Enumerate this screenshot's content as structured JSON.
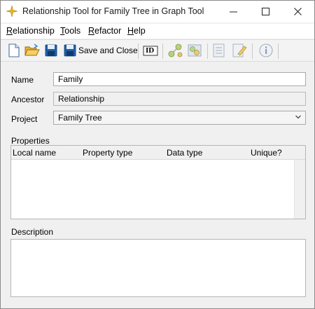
{
  "window": {
    "title": "Relationship Tool for Family Tree in Graph Tool",
    "icon": "sparkle-star-icon",
    "controls": [
      "minimize-icon",
      "maximize-icon",
      "close-icon"
    ]
  },
  "menu": {
    "relationship": {
      "first": "R",
      "rest": "elationship"
    },
    "tools": {
      "first": "T",
      "rest": "ools"
    },
    "refactor": {
      "first": "R",
      "rest": "efactor"
    },
    "help": {
      "first": "H",
      "rest": "elp"
    }
  },
  "toolbar": {
    "save_close_label": "Save and Close",
    "id_label": "ID"
  },
  "form": {
    "name_label": "Name",
    "name_value": "Family",
    "ancestor_label": "Ancestor",
    "ancestor_value": "Relationship",
    "project_label": "Project",
    "project_value": "Family Tree",
    "properties_label": "Properties",
    "columns": [
      "Local name",
      "Property type",
      "Data type",
      "Unique?"
    ],
    "description_label": "Description"
  }
}
